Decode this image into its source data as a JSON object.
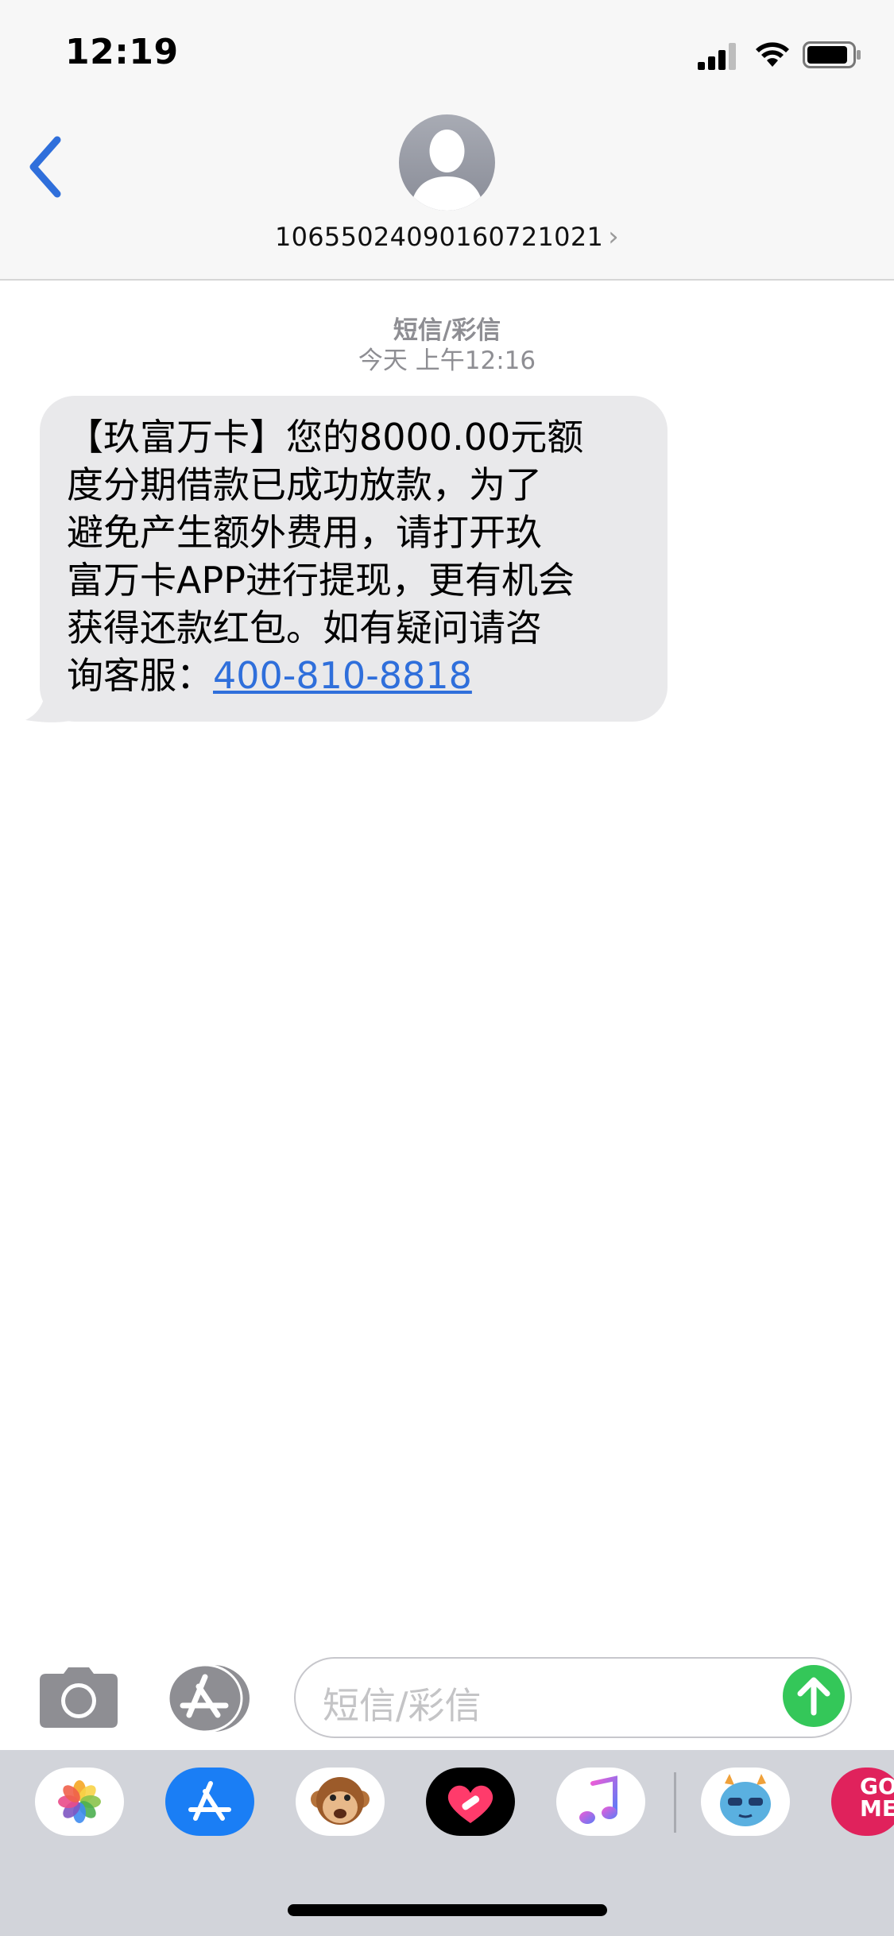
{
  "status_bar": {
    "time": "12:19"
  },
  "header": {
    "contact": "10655024090160721021",
    "contact_chevron": "›"
  },
  "conversation": {
    "type_label": "短信/彩信",
    "date_label": "今天 上午12:16",
    "message": {
      "text": "【玖富万卡】您的8000.00元额\n度分期借款已成功放款，为了\n避免产生额外费用，请打开玖\n富万卡APP进行提现，更有机会\n获得还款红包。如有疑问请咨\n询客服：",
      "phone": "400-810-8818"
    }
  },
  "input_bar": {
    "placeholder": "短信/彩信"
  },
  "app_drawer": {
    "apps": [
      "photos-app-icon",
      "app-store-app-icon",
      "animoji-monkey-icon",
      "digital-touch-heart-icon",
      "music-app-icon",
      "monster-sticker-icon",
      "game-app-icon"
    ],
    "game_label": "GO\nME"
  },
  "colors": {
    "accent": "#2f6fdb",
    "send": "#34c759",
    "bubble": "#e9e9eb",
    "header_bg": "#f7f7f7"
  }
}
